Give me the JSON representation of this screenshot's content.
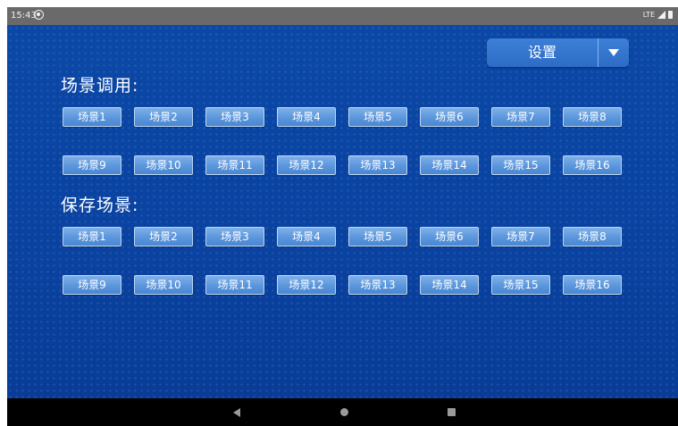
{
  "status_bar": {
    "time": "15:43",
    "notification_icon": "sync-icon",
    "network_label": "LTE",
    "signal_icon": "signal-icon",
    "battery_icon": "battery-icon"
  },
  "settings": {
    "label": "设置",
    "dropdown_icon": "triangle-down-icon"
  },
  "recall_section": {
    "title": "场景调用:",
    "buttons": [
      "场景1",
      "场景2",
      "场景3",
      "场景4",
      "场景5",
      "场景6",
      "场景7",
      "场景8",
      "场景9",
      "场景10",
      "场景11",
      "场景12",
      "场景13",
      "场景14",
      "场景15",
      "场景16"
    ]
  },
  "save_section": {
    "title": "保存场景:",
    "buttons": [
      "场景1",
      "场景2",
      "场景3",
      "场景4",
      "场景5",
      "场景6",
      "场景7",
      "场景8",
      "场景9",
      "场景10",
      "场景11",
      "场景12",
      "场景13",
      "场景14",
      "场景15",
      "场景16"
    ]
  },
  "nav_bar": {
    "back_icon": "back-icon",
    "home_icon": "home-icon",
    "recents_icon": "recents-icon"
  },
  "colors": {
    "background": "#0a44a0",
    "button": "#5b96dc",
    "button_border": "#bcd6f3",
    "text": "#ffffff"
  }
}
